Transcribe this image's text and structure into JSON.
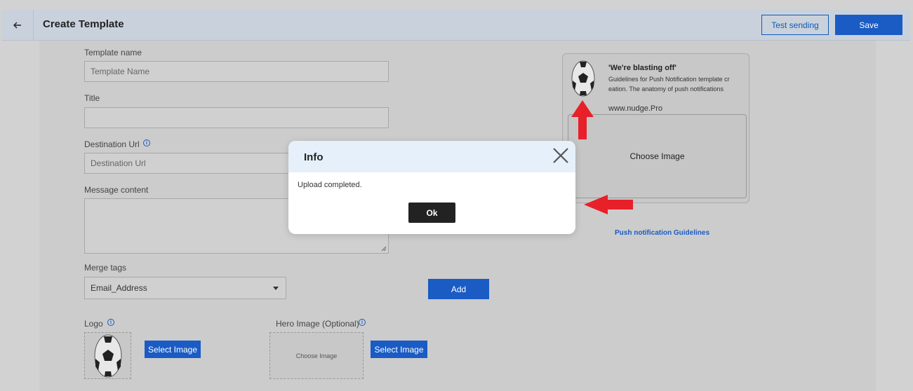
{
  "header": {
    "title": "Create Template",
    "test_sending_label": "Test sending",
    "save_label": "Save"
  },
  "form": {
    "template_name_label": "Template name",
    "template_name_placeholder": "Template Name",
    "title_label": "Title",
    "title_value": "",
    "destination_label": "Destination Url",
    "destination_placeholder": "Destination Url",
    "message_label": "Message content",
    "merge_tags_label": "Merge tags",
    "merge_tags_selected": "Email_Address",
    "add_label": "Add",
    "logo_label": "Logo",
    "logo_select_label": "Select Image",
    "hero_label": "Hero Image (Optional)",
    "hero_choose_text": "Choose Image",
    "hero_select_label": "Select Image"
  },
  "preview": {
    "title": "'We're blasting off'",
    "body": "Guidelines for Push Notification template creation. The anatomy of push notifications",
    "url": "www.nudge.Pro",
    "choose_image": "Choose Image"
  },
  "guidelines_link": "Push notification Guidelines",
  "modal": {
    "title": "Info",
    "message": "Upload completed.",
    "ok_label": "Ok"
  },
  "colors": {
    "accent": "#1a5bc4",
    "annotation_arrow": "#e8202a",
    "modal_header_bg": "#e6f0fb"
  }
}
